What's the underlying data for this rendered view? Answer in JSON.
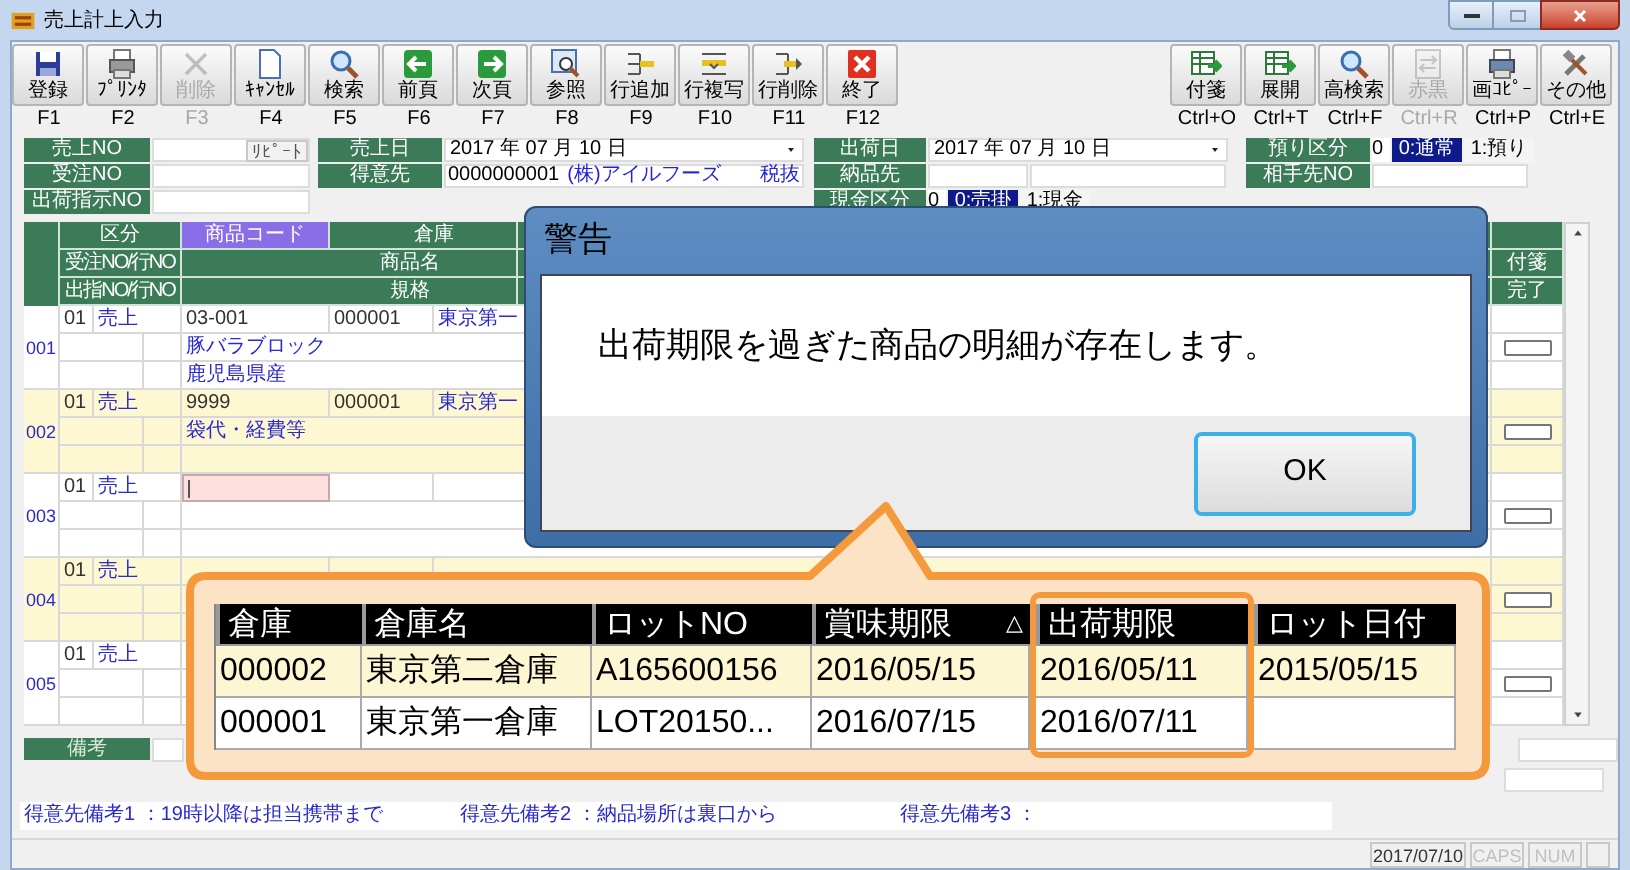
{
  "window": {
    "title": "売上計上入力"
  },
  "toolbar": {
    "left": [
      {
        "label": "登録",
        "key": "F1",
        "disabled": false
      },
      {
        "label": "ﾌﾟﾘﾝﾀ",
        "key": "F2",
        "disabled": false
      },
      {
        "label": "削除",
        "key": "F3",
        "disabled": true
      },
      {
        "label": "ｷｬﾝｾﾙ",
        "key": "F4",
        "disabled": false
      },
      {
        "label": "検索",
        "key": "F5",
        "disabled": false
      },
      {
        "label": "前頁",
        "key": "F6",
        "disabled": false
      },
      {
        "label": "次頁",
        "key": "F7",
        "disabled": false
      },
      {
        "label": "参照",
        "key": "F8",
        "disabled": false
      },
      {
        "label": "行追加",
        "key": "F9",
        "disabled": false
      },
      {
        "label": "行複写",
        "key": "F10",
        "disabled": false
      },
      {
        "label": "行削除",
        "key": "F11",
        "disabled": false
      },
      {
        "label": "終了",
        "key": "F12",
        "disabled": false
      }
    ],
    "right": [
      {
        "label": "付箋",
        "key": "Ctrl+O",
        "disabled": false
      },
      {
        "label": "展開",
        "key": "Ctrl+T",
        "disabled": false
      },
      {
        "label": "高検索",
        "key": "Ctrl+F",
        "disabled": false
      },
      {
        "label": "赤黒",
        "key": "Ctrl+R",
        "disabled": true
      },
      {
        "label": "画ｺﾋﾟｰ",
        "key": "Ctrl+P",
        "disabled": false
      },
      {
        "label": "その他",
        "key": "Ctrl+E",
        "disabled": false
      }
    ]
  },
  "header": {
    "sales_no": {
      "label": "売上NO",
      "button": "ﾘﾋﾟｰﾄ"
    },
    "order_no": {
      "label": "受注NO"
    },
    "shipping_instruction_no": {
      "label": "出荷指示NO"
    },
    "sales_date": {
      "label": "売上日",
      "value": "2017 年 07 月 10 日"
    },
    "customer": {
      "label": "得意先",
      "code": "0000000001",
      "name": "(株)アイルフーズ",
      "tax": "税抜"
    },
    "ship_date": {
      "label": "出荷日",
      "value": "2017 年 07 月 10 日"
    },
    "delivery_to": {
      "label": "納品先"
    },
    "cash_type": {
      "label": "現金区分",
      "value": "0",
      "options": [
        {
          "label": "0:売掛",
          "selected": true
        },
        {
          "label": "1:現金",
          "selected": false
        }
      ]
    },
    "deposit_type": {
      "label": "預り区分",
      "value": "0",
      "options": [
        {
          "label": "0:通常",
          "selected": true
        },
        {
          "label": "1:預り",
          "selected": false
        }
      ]
    },
    "partner_no": {
      "label": "相手先NO"
    }
  },
  "grid": {
    "header": {
      "row_1": [
        {
          "label": "区分",
          "selected": false
        },
        {
          "label": "商品コード",
          "selected": true
        },
        {
          "label": "倉庫",
          "selected": false
        }
      ],
      "row_2": [
        "受注NO/行NO",
        "商品名",
        "付箋"
      ],
      "row_3": [
        "出指NO/行NO",
        "規格",
        "完了"
      ]
    },
    "rows": [
      {
        "no": "001",
        "type_code": "01",
        "type": "売上",
        "product_code": "03-001",
        "warehouse_code": "000001",
        "warehouse_name": "東京第一",
        "product_name": "豚バラブロック",
        "spec": "鹿児島県産",
        "editing": false,
        "note_checked": false
      },
      {
        "no": "002",
        "type_code": "01",
        "type": "売上",
        "product_code": "9999",
        "warehouse_code": "000001",
        "warehouse_name": "東京第一",
        "product_name": "袋代・経費等",
        "editing": false,
        "note_checked": false
      },
      {
        "no": "003",
        "type_code": "01",
        "type": "売上",
        "editing": true,
        "note_checked": false
      },
      {
        "no": "004",
        "type_code": "01",
        "type": "売上",
        "editing": false,
        "note_checked": false
      },
      {
        "no": "005",
        "type_code": "01",
        "type": "売上",
        "editing": false,
        "note_checked": false
      }
    ]
  },
  "remarks": {
    "label": "備考"
  },
  "customer_notes": [
    "得意先備考1 ：19時以降は担当携帯まで",
    "得意先備考2 ：納品場所は裏口から",
    "得意先備考3 ："
  ],
  "status_bar": {
    "date": "2017/07/10",
    "indicators": [
      {
        "label": "CAPS",
        "active": false
      },
      {
        "label": "NUM",
        "active": false
      }
    ]
  },
  "dialog": {
    "title": "警告",
    "message": "出荷期限を過ぎた商品の明細が存在します。",
    "button": "OK"
  },
  "callout": {
    "columns": [
      {
        "label": "倉庫",
        "highlighted": false
      },
      {
        "label": "倉庫名",
        "highlighted": false
      },
      {
        "label": "ロットNO",
        "highlighted": false
      },
      {
        "label": "賞味期限",
        "sort": "△",
        "highlighted": false
      },
      {
        "label": "出荷期限",
        "highlighted": true
      },
      {
        "label": "ロット日付",
        "highlighted": false
      }
    ],
    "rows": [
      {
        "selected": true,
        "cells": [
          "000002",
          "東京第二倉庫",
          "A165600156",
          "2016/05/15",
          "2016/05/11",
          "2015/05/15"
        ]
      },
      {
        "selected": false,
        "cells": [
          "000001",
          "東京第一倉庫",
          "LOT20150...",
          "2016/07/15",
          "2016/07/11"
        ]
      }
    ]
  }
}
